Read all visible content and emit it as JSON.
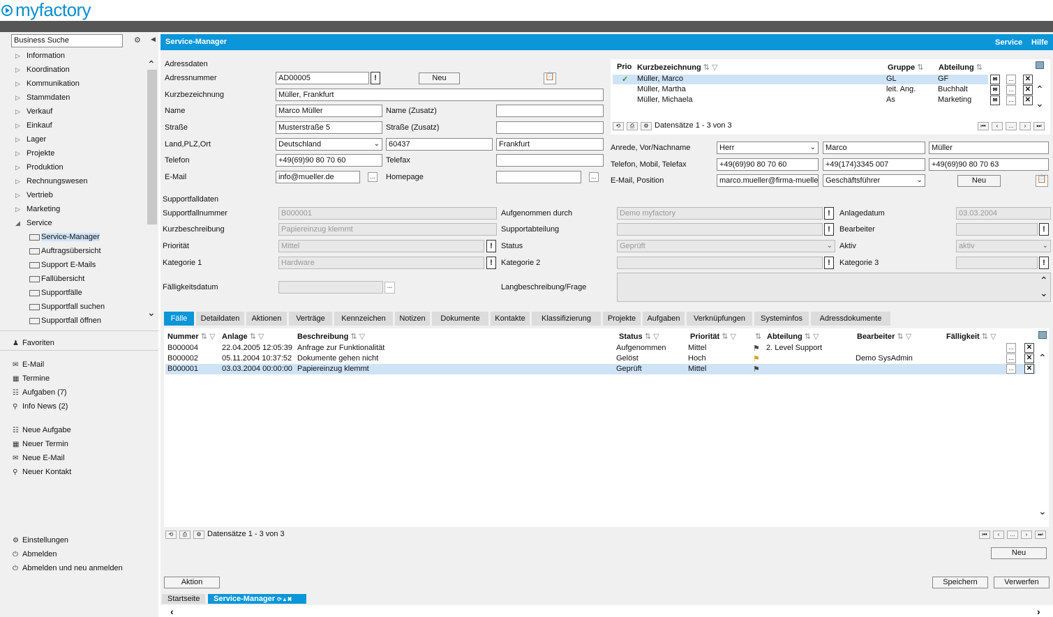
{
  "app": {
    "logo": "myfactory"
  },
  "sidebar": {
    "search_value": "Business Suche",
    "nav": [
      "Information",
      "Koordination",
      "Kommunikation",
      "Stammdaten",
      "Verkauf",
      "Einkauf",
      "Lager",
      "Projekte",
      "Produktion",
      "Rechnungswesen",
      "Vertrieb",
      "Marketing"
    ],
    "service_label": "Service",
    "service_children": [
      "Service-Manager",
      "Auftragsübersicht",
      "Support E-Mails",
      "Fallübersicht",
      "Supportfälle",
      "Supportfall suchen",
      "Supportfall öffnen"
    ],
    "favorites": "Favoriten",
    "quick1": [
      "E-Mail",
      "Termine",
      "Aufgaben (7)",
      "Info News (2)"
    ],
    "quick2": [
      "Neue Aufgabe",
      "Neuer Termin",
      "Neue E-Mail",
      "Neuer Kontakt"
    ],
    "settings": [
      "Einstellungen",
      "Abmelden",
      "Abmelden und neu anmelden"
    ]
  },
  "header": {
    "title": "Service-Manager",
    "service": "Service",
    "help": "Hilfe"
  },
  "address": {
    "section": "Adressdaten",
    "nr_label": "Adressnummer",
    "nr_value": "AD00005",
    "new_btn": "Neu",
    "short_label": "Kurzbezeichnung",
    "short_value": "Müller, Frankfurt",
    "name_label": "Name",
    "name_value": "Marco Müller",
    "name2_label": "Name (Zusatz)",
    "name2_value": "",
    "street_label": "Straße",
    "street_value": "Musterstraße 5",
    "street2_label": "Straße (Zusatz)",
    "street2_value": "",
    "country_label": "Land,PLZ,Ort",
    "country_value": "Deutschland",
    "zip_value": "60437",
    "city_value": "Frankfurt",
    "phone_label": "Telefon",
    "phone_value": "+49(69)90 80 70 60",
    "fax_label": "Telefax",
    "fax_value": "",
    "email_label": "E-Mail",
    "email_value": "info@mueller.de",
    "homepage_label": "Homepage",
    "homepage_value": ""
  },
  "contacts": {
    "headers": {
      "prio": "Prio",
      "short": "Kurzbezeichnung",
      "group": "Gruppe",
      "dept": "Abteilung"
    },
    "rows": [
      {
        "name": "Müller, Marco",
        "group": "GL",
        "dept": "GF"
      },
      {
        "name": "Müller, Martha",
        "group": "leit. Ang.",
        "dept": "Buchhalt"
      },
      {
        "name": "Müller, Michaela",
        "group": "As",
        "dept": "Marketing"
      }
    ],
    "records": "Datensätze 1 - 3 von 3",
    "salutation_label": "Anrede, Vor/Nachname",
    "salutation": "Herr",
    "first": "Marco",
    "last": "Müller",
    "phones_label": "Telefon, Mobil, Telefax",
    "phone": "+49(69)90 80 70 60",
    "mobile": "+49(174)3345 007",
    "fax": "+49(69)90 80 70 63",
    "email_label": "E-Mail, Position",
    "email": "marco.mueller@firma-mueller",
    "position": "Geschäftsführer",
    "new_btn": "Neu"
  },
  "support": {
    "section": "Supportfalldaten",
    "nr_label": "Supportfallnummer",
    "nr_value": "B000001",
    "short_label": "Kurzbeschreibung",
    "short_value": "Papiereinzug klemmt",
    "prio_label": "Priorität",
    "prio_value": "Mittel",
    "cat1_label": "Kategorie 1",
    "cat1_value": "Hardware",
    "due_label": "Fälligkeitsdatum",
    "recorded_label": "Aufgenommen durch",
    "recorded_value": "Demo myfactory",
    "dept_label": "Supportabteilung",
    "dept_value": "",
    "status_label": "Status",
    "status_value": "Geprüft",
    "cat2_label": "Kategorie 2",
    "cat2_value": "",
    "longdesc_label": "Langbeschreibung/Frage",
    "created_label": "Anlagedatum",
    "created_value": "03.03.2004",
    "editor_label": "Bearbeiter",
    "editor_value": "",
    "active_label": "Aktiv",
    "active_value": "aktiv",
    "cat3_label": "Kategorie 3",
    "cat3_value": ""
  },
  "tabs": [
    "Fälle",
    "Detaildaten",
    "Aktionen",
    "Verträge",
    "Kennzeichen",
    "Notizen",
    "Dokumente",
    "Kontakte",
    "Klassifizierung",
    "Projekte",
    "Aufgaben",
    "Verknüpfungen",
    "Systeminfos",
    "Adressdokumente"
  ],
  "grid": {
    "headers": {
      "nr": "Nummer",
      "created": "Anlage",
      "desc": "Beschreibung",
      "status": "Status",
      "prio": "Priorität",
      "dept": "Abteilung",
      "editor": "Bearbeiter",
      "due": "Fälligkeit"
    },
    "rows": [
      {
        "nr": "B000004",
        "created": "22.04.2005 12:05:39",
        "desc": "Anfrage zur Funktionalität",
        "status": "Aufgenommen",
        "prio": "Mittel",
        "dept": "2. Level Support",
        "editor": ""
      },
      {
        "nr": "B000002",
        "created": "05.11.2004 10:37:52",
        "desc": "Dokumente gehen nicht",
        "status": "Gelöst",
        "prio": "Hoch",
        "dept": "",
        "editor": "Demo SysAdmin"
      },
      {
        "nr": "B000001",
        "created": "03.03.2004 00:00:00",
        "desc": "Papiereinzug klemmt",
        "status": "Geprüft",
        "prio": "Mittel",
        "dept": "",
        "editor": ""
      }
    ],
    "records": "Datensätze 1 - 3 von 3",
    "new_btn": "Neu"
  },
  "footer": {
    "action": "Aktion",
    "save": "Speichern",
    "discard": "Verwerfen"
  },
  "bottom_tabs": {
    "start": "Startseite",
    "current": "Service-Manager"
  }
}
